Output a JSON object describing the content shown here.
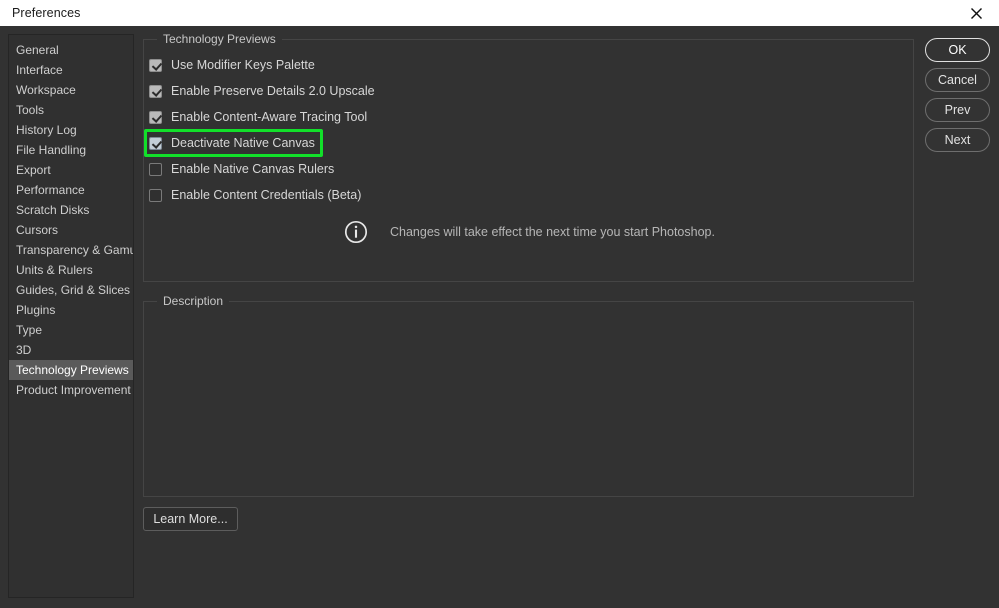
{
  "window": {
    "title": "Preferences",
    "close_icon": "close-icon"
  },
  "sidebar": {
    "items": [
      {
        "label": "General",
        "selected": false
      },
      {
        "label": "Interface",
        "selected": false
      },
      {
        "label": "Workspace",
        "selected": false
      },
      {
        "label": "Tools",
        "selected": false
      },
      {
        "label": "History Log",
        "selected": false
      },
      {
        "label": "File Handling",
        "selected": false
      },
      {
        "label": "Export",
        "selected": false
      },
      {
        "label": "Performance",
        "selected": false
      },
      {
        "label": "Scratch Disks",
        "selected": false
      },
      {
        "label": "Cursors",
        "selected": false
      },
      {
        "label": "Transparency & Gamut",
        "selected": false
      },
      {
        "label": "Units & Rulers",
        "selected": false
      },
      {
        "label": "Guides, Grid & Slices",
        "selected": false
      },
      {
        "label": "Plugins",
        "selected": false
      },
      {
        "label": "Type",
        "selected": false
      },
      {
        "label": "3D",
        "selected": false
      },
      {
        "label": "Technology Previews",
        "selected": true
      },
      {
        "label": "Product Improvement",
        "selected": false
      }
    ]
  },
  "tech_previews": {
    "group_label": "Technology Previews",
    "options": [
      {
        "label": "Use Modifier Keys Palette",
        "checked": true,
        "highlighted": false
      },
      {
        "label": "Enable Preserve Details 2.0 Upscale",
        "checked": true,
        "highlighted": false
      },
      {
        "label": "Enable Content-Aware Tracing Tool",
        "checked": true,
        "highlighted": false
      },
      {
        "label": "Deactivate Native Canvas",
        "checked": true,
        "highlighted": true
      },
      {
        "label": "Enable Native Canvas Rulers",
        "checked": false,
        "highlighted": false
      },
      {
        "label": "Enable Content Credentials (Beta)",
        "checked": false,
        "highlighted": false
      }
    ],
    "note": {
      "icon": "info-icon",
      "text": "Changes will take effect the next time you start Photoshop."
    },
    "highlight_color": "#12e02a"
  },
  "description": {
    "group_label": "Description",
    "content": ""
  },
  "learn_more": {
    "label": "Learn More..."
  },
  "buttons": [
    {
      "label": "OK",
      "primary": true
    },
    {
      "label": "Cancel",
      "primary": false
    },
    {
      "label": "Prev",
      "primary": false
    },
    {
      "label": "Next",
      "primary": false
    }
  ]
}
